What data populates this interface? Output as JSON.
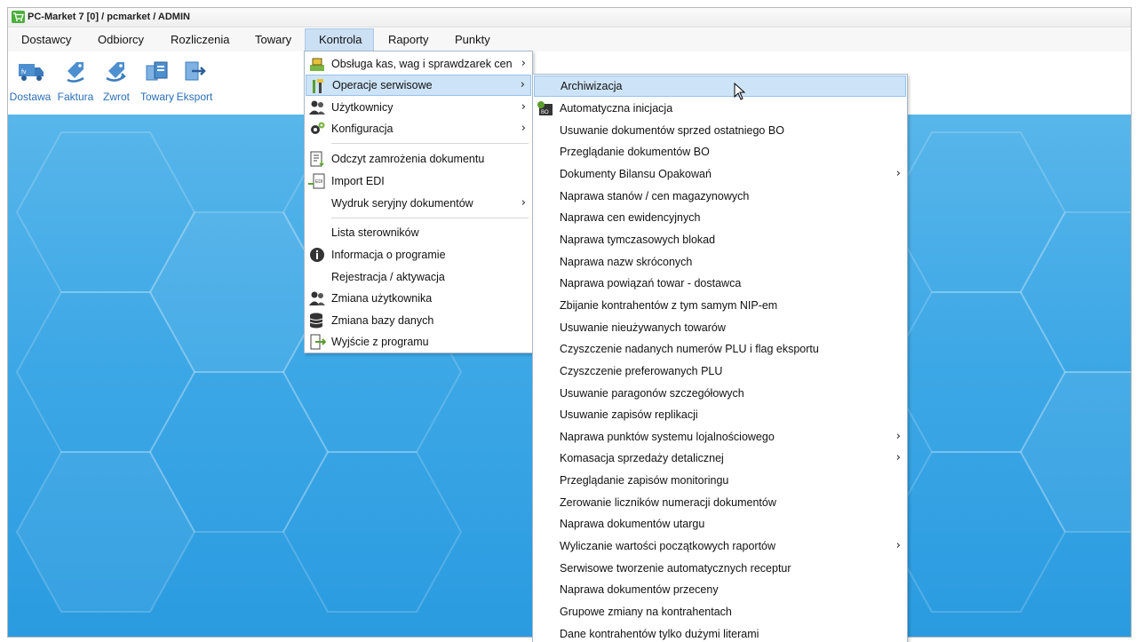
{
  "window": {
    "title": "PC-Market 7 [0] / pcmarket / ADMIN"
  },
  "menubar": [
    {
      "label": "Dostawcy"
    },
    {
      "label": "Odbiorcy"
    },
    {
      "label": "Rozliczenia"
    },
    {
      "label": "Towary"
    },
    {
      "label": "Kontrola"
    },
    {
      "label": "Raporty"
    },
    {
      "label": "Punkty"
    }
  ],
  "toolbar": [
    {
      "label": "Dostawa",
      "icon": "delivery-truck-icon"
    },
    {
      "label": "Faktura",
      "icon": "invoice-tag-icon"
    },
    {
      "label": "Zwrot",
      "icon": "return-tag-icon"
    },
    {
      "label": "Towary",
      "icon": "products-icon"
    },
    {
      "label": "Eksport",
      "icon": "export-icon"
    }
  ],
  "kontrola_menu": [
    {
      "label": "Obsługa kas, wag i sprawdzarek cen",
      "submenu": true,
      "icon": "scale-icon"
    },
    {
      "label": "Operacje serwisowe",
      "submenu": true,
      "icon": "tools-icon",
      "highlighted": true
    },
    {
      "label": "Użytkownicy",
      "submenu": true,
      "icon": "users-icon"
    },
    {
      "label": "Konfiguracja",
      "submenu": true,
      "icon": "gears-icon"
    },
    {
      "label": "Odczyt zamrożenia dokumentu",
      "submenu": false,
      "icon": "document-freeze-icon"
    },
    {
      "label": "Import EDI",
      "submenu": false,
      "icon": "edi-import-icon"
    },
    {
      "label": "Wydruk seryjny dokumentów",
      "submenu": true,
      "icon": ""
    },
    {
      "label": "Lista sterowników",
      "submenu": false,
      "icon": ""
    },
    {
      "label": "Informacja o programie",
      "submenu": false,
      "icon": "info-icon"
    },
    {
      "label": "Rejestracja / aktywacja",
      "submenu": false,
      "icon": ""
    },
    {
      "label": "Zmiana użytkownika",
      "submenu": false,
      "icon": "switch-user-icon"
    },
    {
      "label": "Zmiana bazy danych",
      "submenu": false,
      "icon": "database-icon"
    },
    {
      "label": "Wyjście z programu",
      "submenu": false,
      "icon": "exit-icon"
    }
  ],
  "serwis_menu": [
    {
      "label": "Archiwizacja",
      "submenu": false,
      "highlighted": true
    },
    {
      "label": "Automatyczna inicjacja",
      "submenu": false,
      "icon": "bo-icon"
    },
    {
      "label": "Usuwanie dokumentów sprzed ostatniego BO",
      "submenu": false
    },
    {
      "label": "Przeglądanie dokumentów BO",
      "submenu": false
    },
    {
      "label": "Dokumenty Bilansu Opakowań",
      "submenu": true
    },
    {
      "label": "Naprawa stanów / cen magazynowych",
      "submenu": false
    },
    {
      "label": "Naprawa cen ewidencyjnych",
      "submenu": false
    },
    {
      "label": "Naprawa tymczasowych blokad",
      "submenu": false
    },
    {
      "label": "Naprawa nazw skróconych",
      "submenu": false
    },
    {
      "label": "Naprawa powiązań towar - dostawca",
      "submenu": false
    },
    {
      "label": "Zbijanie kontrahentów z tym samym NIP-em",
      "submenu": false
    },
    {
      "label": "Usuwanie nieużywanych towarów",
      "submenu": false
    },
    {
      "label": "Czyszczenie nadanych numerów PLU i flag eksportu",
      "submenu": false
    },
    {
      "label": "Czyszczenie preferowanych PLU",
      "submenu": false
    },
    {
      "label": "Usuwanie paragonów szczegółowych",
      "submenu": false
    },
    {
      "label": "Usuwanie zapisów replikacji",
      "submenu": false
    },
    {
      "label": "Naprawa punktów systemu lojalnościowego",
      "submenu": true
    },
    {
      "label": "Komasacja sprzedaży detalicznej",
      "submenu": true
    },
    {
      "label": "Przeglądanie zapisów monitoringu",
      "submenu": false
    },
    {
      "label": "Zerowanie liczników numeracji dokumentów",
      "submenu": false
    },
    {
      "label": "Naprawa dokumentów utargu",
      "submenu": false
    },
    {
      "label": "Wyliczanie wartości początkowych  raportów",
      "submenu": true
    },
    {
      "label": "Serwisowe tworzenie automatycznych receptur",
      "submenu": false
    },
    {
      "label": "Naprawa dokumentów przeceny",
      "submenu": false
    },
    {
      "label": "Grupowe zmiany na kontrahentach",
      "submenu": false
    },
    {
      "label": "Dane kontrahentów tylko dużymi literami",
      "submenu": false
    }
  ],
  "colors": {
    "accent": "#2a6fb8",
    "highlight": "#cde3f7",
    "desktop": "#3ea8e6"
  }
}
